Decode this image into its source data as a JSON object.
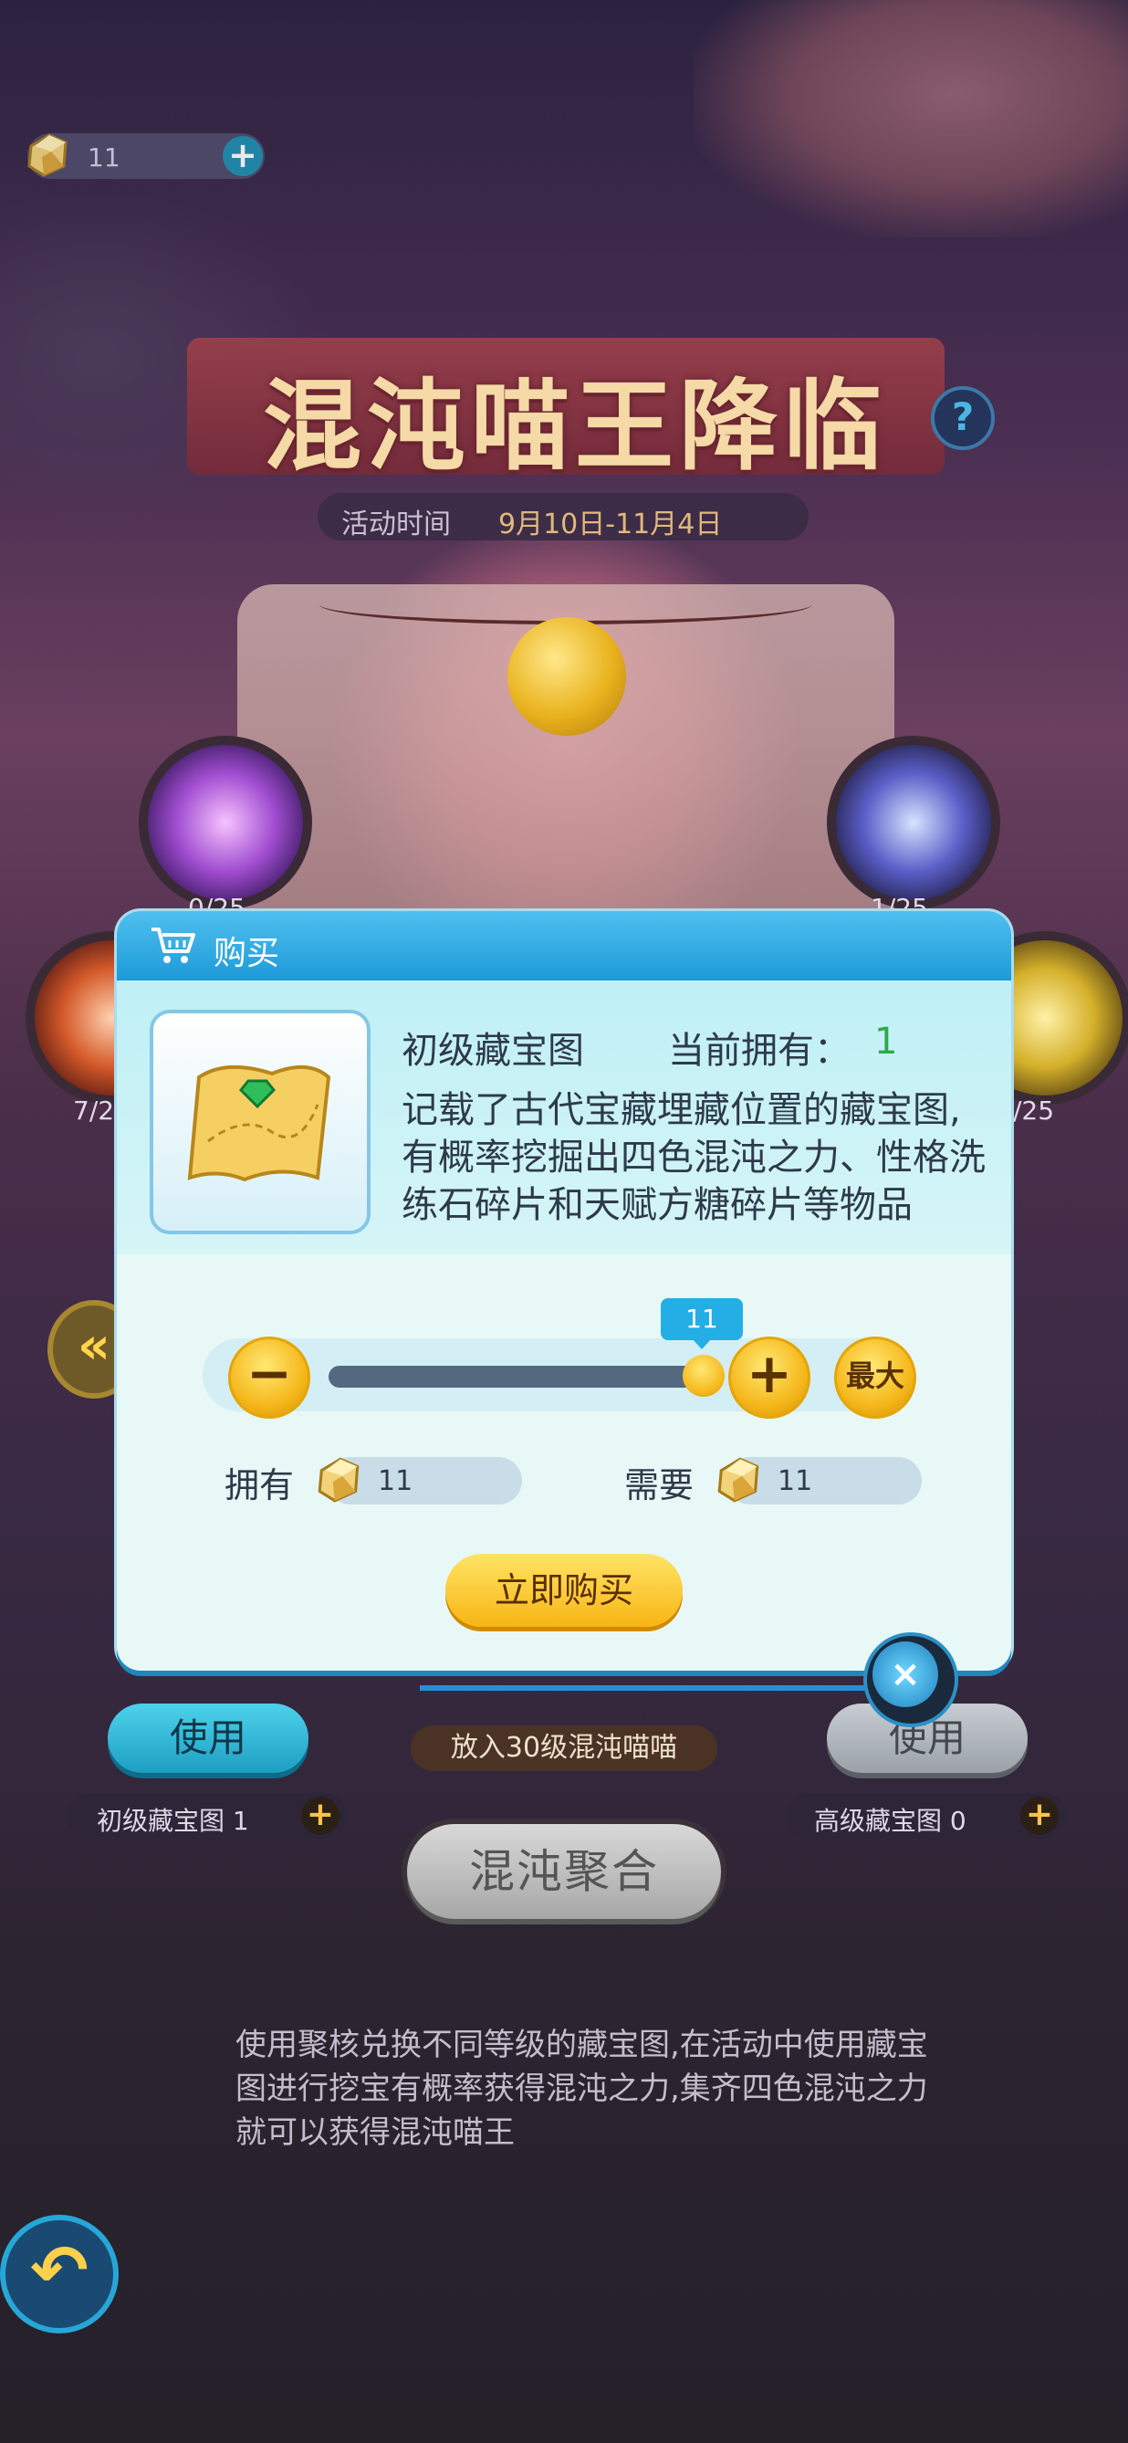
{
  "currency": {
    "value": "11",
    "plus": "+"
  },
  "title": "混沌喵王降临",
  "help": "?",
  "event_time": {
    "label": "活动时间",
    "dates": "9月10日-11月4日"
  },
  "vortex_counts": {
    "top_left": "0/25",
    "top_right": "1/25",
    "mid_left": "7/2",
    "mid_right": "/25"
  },
  "dialog": {
    "title": "购买",
    "item_name": "初级藏宝图",
    "own_label": "当前拥有：",
    "own_count": "1",
    "description": "记载了古代宝藏埋藏位置的藏宝图,有概率挖掘出四色混沌之力、性格洗练石碎片和天赋方糖碎片等物品",
    "quantity": "11",
    "quantity_fraction": 1.0,
    "minus": "−",
    "plus": "+",
    "max": "最大",
    "have_label": "拥有",
    "have_value": "11",
    "need_label": "需要",
    "need_value": "11",
    "buy_button": "立即购买",
    "close": "×"
  },
  "controls": {
    "use_left": "使用",
    "use_right": "使用",
    "put_in": "放入30级混沌喵喵",
    "map_left": "初级藏宝图 1",
    "map_right": "高级藏宝图 0",
    "map_plus": "+",
    "fusion": "混沌聚合",
    "side_arrow": "«"
  },
  "footer": "使用聚核兑换不同等级的藏宝图,在活动中使用藏宝图进行挖宝有概率获得混沌之力,集齐四色混沌之力就可以获得混沌喵王",
  "colors": {
    "accent_blue": "#1e9ad8",
    "gold": "#f5b81c",
    "own_green": "#2ea84a"
  }
}
